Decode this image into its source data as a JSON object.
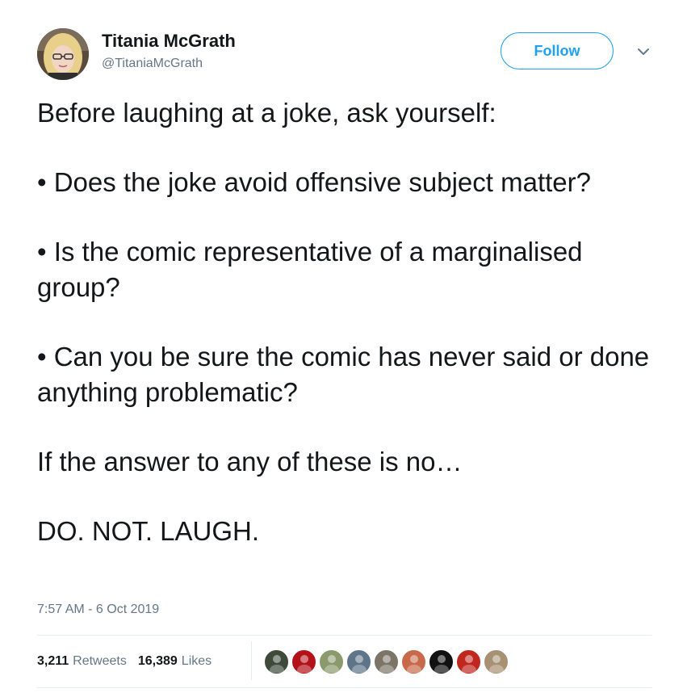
{
  "author": {
    "name": "Titania McGrath",
    "handle": "@TitaniaMcGrath",
    "avatar_icon": "profile-photo-avatar"
  },
  "follow": {
    "label": "Follow",
    "color": "#1da1f2"
  },
  "menu": {
    "icon": "chevron-down-icon"
  },
  "tweet": {
    "paragraphs": [
      "Before laughing at a joke, ask yourself:",
      "• Does the joke avoid offensive subject matter?",
      "• Is the comic representative of a marginalised group?",
      "• Can you be sure the comic has never said or done anything problematic?",
      "If the answer to any of these is no…",
      "DO. NOT. LAUGH."
    ],
    "timestamp": "7:57 AM - 6 Oct 2019"
  },
  "stats": {
    "retweets": {
      "count": "3,211",
      "label": "Retweets"
    },
    "likes": {
      "count": "16,389",
      "label": "Likes"
    }
  },
  "likers": [
    {
      "icon": "liker-avatar-1",
      "color": "#3e4a3a"
    },
    {
      "icon": "liker-avatar-2",
      "color": "#b3121b"
    },
    {
      "icon": "liker-avatar-3",
      "color": "#8a9a6c"
    },
    {
      "icon": "liker-avatar-4",
      "color": "#5d7489"
    },
    {
      "icon": "liker-avatar-5",
      "color": "#7d7468"
    },
    {
      "icon": "liker-avatar-6",
      "color": "#c86a4a"
    },
    {
      "icon": "liker-avatar-7",
      "color": "#111111"
    },
    {
      "icon": "liker-avatar-8",
      "color": "#c0281f"
    },
    {
      "icon": "liker-avatar-9",
      "color": "#a89072"
    }
  ],
  "colors": {
    "text": "#14171a",
    "secondary": "#657786",
    "divider": "#e6ecf0"
  }
}
